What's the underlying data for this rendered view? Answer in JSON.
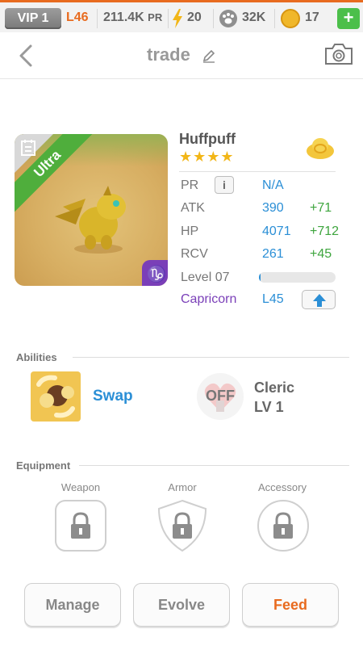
{
  "status_bar": {
    "vip": "VIP 1",
    "level": "L46",
    "power": "211.4K",
    "power_unit": "PR",
    "energy": "20",
    "paws": "32K",
    "coins": "17",
    "add_label": "+"
  },
  "header": {
    "title": "trade"
  },
  "monster": {
    "name": "Huffpuff",
    "rarity": "Ultra",
    "stars": "★★★★",
    "star_count": 4,
    "stats": [
      {
        "label": "PR",
        "value": "N/A",
        "bonus": ""
      },
      {
        "label": "ATK",
        "value": "390",
        "bonus": "+71"
      },
      {
        "label": "HP",
        "value": "4071",
        "bonus": "+712"
      },
      {
        "label": "RCV",
        "value": "261",
        "bonus": "+45"
      }
    ],
    "info_label": "i",
    "level_label": "Level 07",
    "xp_fraction": 0.02,
    "zodiac": "Capricorn",
    "zodiac_level": "L45",
    "zodiac_symbol": "♑"
  },
  "abilities": {
    "heading": "Abilities",
    "items": [
      {
        "name": "Swap",
        "state": ""
      },
      {
        "name": "Cleric",
        "level": "LV 1",
        "state": "OFF"
      }
    ]
  },
  "equipment": {
    "heading": "Equipment",
    "slots": [
      "Weapon",
      "Armor",
      "Accessory"
    ]
  },
  "actions": {
    "manage": "Manage",
    "evolve": "Evolve",
    "feed": "Feed"
  },
  "colors": {
    "accent_orange": "#e86b1f",
    "stat_blue": "#2b8fd6",
    "bonus_green": "#3ea53e",
    "zodiac_purple": "#7a3fb8",
    "rarity_green": "#4fae3c"
  }
}
